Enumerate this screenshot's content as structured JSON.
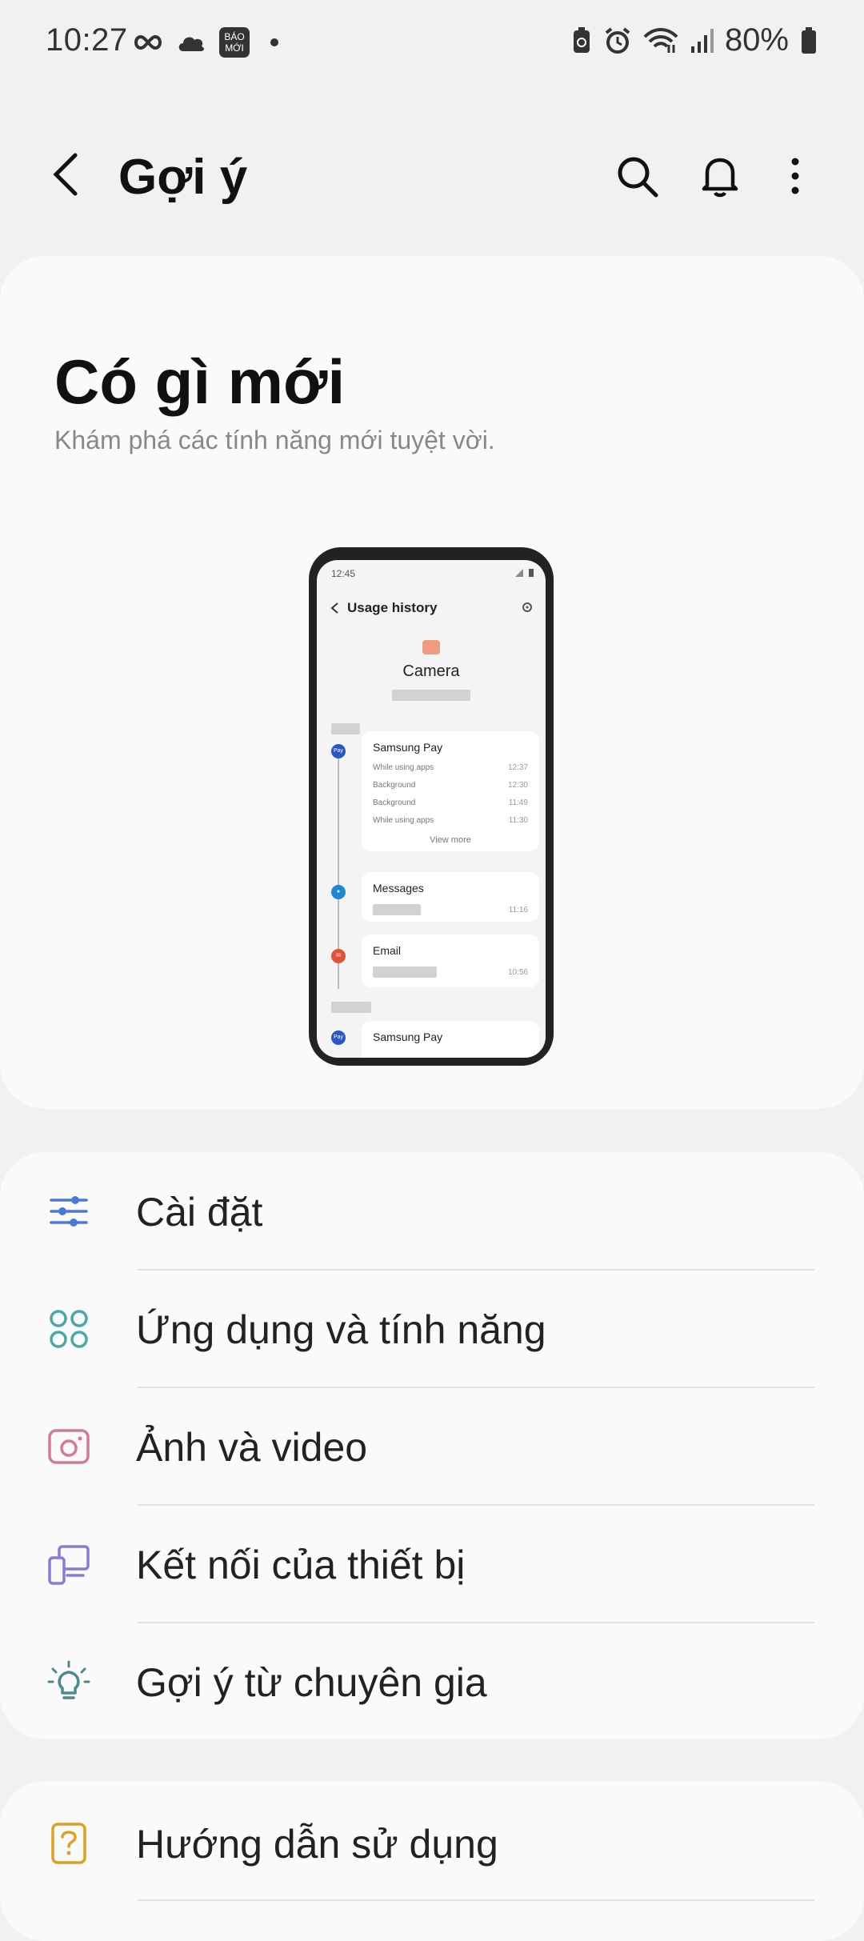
{
  "status_bar": {
    "time": "10:27",
    "battery": "80%"
  },
  "appbar": {
    "title": "Gợi ý"
  },
  "whats_new": {
    "title": "Có gì mới",
    "subtitle": "Khám phá các tính năng mới tuyệt vời.",
    "preview": {
      "time": "12:45",
      "header": "Usage history",
      "app": "Camera",
      "cards": [
        {
          "name": "Samsung Pay",
          "rows": [
            {
              "label": "While using apps",
              "time": "12:37"
            },
            {
              "label": "Background",
              "time": "12:30"
            },
            {
              "label": "Background",
              "time": "11:49"
            },
            {
              "label": "While using apps",
              "time": "11:30"
            }
          ],
          "more": "View more"
        },
        {
          "name": "Messages",
          "time": "11:16"
        },
        {
          "name": "Email",
          "time": "10:56"
        },
        {
          "name": "Samsung Pay"
        }
      ]
    }
  },
  "menu": {
    "items": [
      {
        "label": "Cài đặt",
        "icon": "sliders-icon",
        "color": "#4a78d6"
      },
      {
        "label": "Ứng dụng và tính năng",
        "icon": "apps-grid-icon",
        "color": "#4aa8a8"
      },
      {
        "label": "Ảnh và video",
        "icon": "camera-icon",
        "color": "#d47a95"
      },
      {
        "label": "Kết nối của thiết bị",
        "icon": "devices-icon",
        "color": "#8d7ad8"
      },
      {
        "label": "Gợi ý từ chuyên gia",
        "icon": "lightbulb-icon",
        "color": "#4a8a90"
      }
    ]
  },
  "guide": {
    "label": "Hướng dẫn sử dụng",
    "icon": "help-icon",
    "color": "#e0a020"
  }
}
